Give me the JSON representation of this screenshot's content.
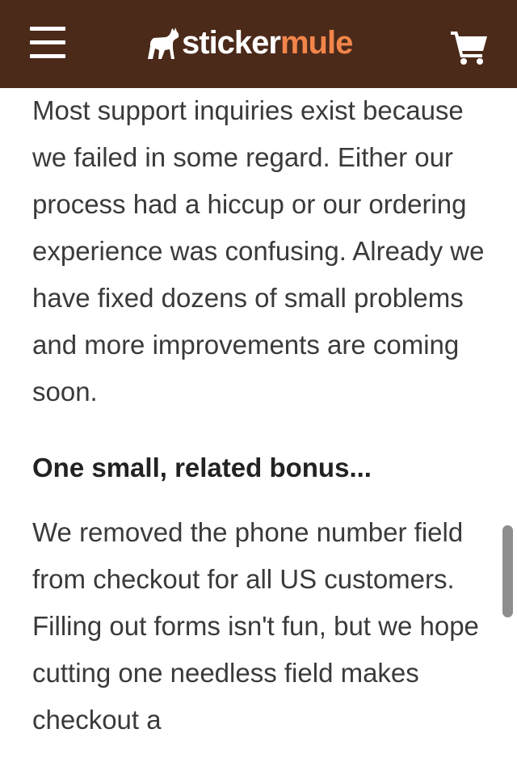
{
  "header": {
    "logo_word_1": "sticker",
    "logo_word_2": "mule",
    "background": "#4b2a1a",
    "accent": "#f2854a",
    "menu_icon": "hamburger-menu-icon",
    "cart_icon": "shopping-cart-icon"
  },
  "article": {
    "paragraph_1": "Most support inquiries exist because we failed in some regard. Either our process had a hiccup or our ordering experience was confusing. Already we have fixed dozens of small problems and more improvements are coming soon.",
    "heading": "One small, related bonus...",
    "paragraph_2": "We removed the phone number field from checkout for all US customers. Filling out forms isn't fun, but we hope cutting one needless field makes checkout a"
  }
}
